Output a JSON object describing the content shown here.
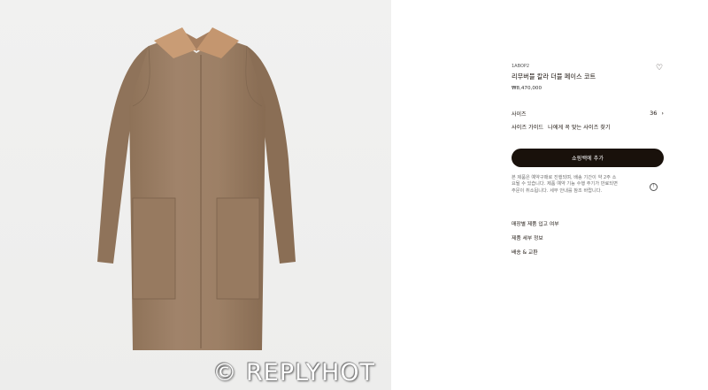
{
  "product": {
    "sku": "1ABOP2",
    "name": "리무버블 칼라 더블 페이스 코트",
    "price": "₩8,470,000"
  },
  "size": {
    "label": "사이즈",
    "value": "36"
  },
  "guide": {
    "size_guide": "사이즈 가이드",
    "find_size": "나에게 꼭 맞는 사이즈 찾기"
  },
  "cart": {
    "button_label": "쇼핑백에 추가"
  },
  "notice": {
    "line1": "본 제품은 예약구매로 진행되며, 배송 기간이 약 2주 소",
    "line2": "요될 수 있습니다. 제품 예약 기능 수행 주기가 만료되면",
    "line3": "주문이 취소됩니다. 세부 안내를 참조 바랍니다."
  },
  "links": {
    "store_stock": "매장별 제품 입고 여부",
    "details": "제품 세부 정보",
    "shipping": "배송 & 교환"
  },
  "watermark": "© REPLYHOT",
  "colors": {
    "coat": "#9b7e62",
    "collar": "#c89b74",
    "background_left": "#efefee",
    "button": "#19110b"
  },
  "icons": {
    "wishlist": "heart-icon",
    "size_next": "chevron-right-icon",
    "info": "info-icon"
  }
}
